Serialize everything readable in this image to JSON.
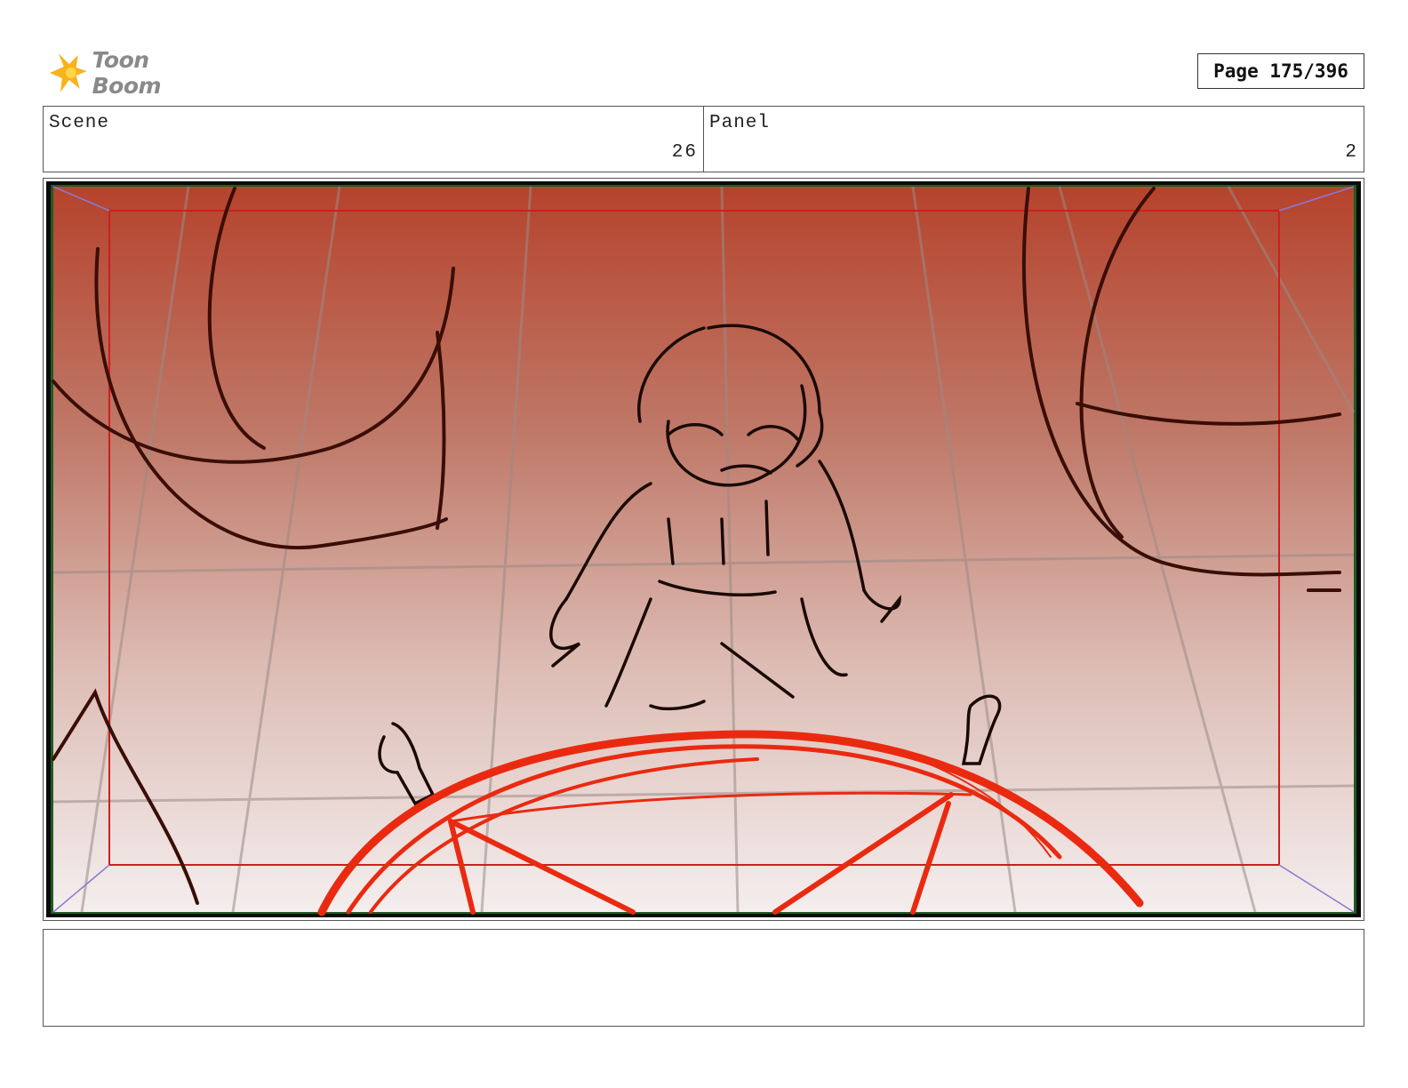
{
  "header": {
    "logo_text": "Toon Boom",
    "page_label": "Page 175/396"
  },
  "fields": {
    "scene_label": "Scene",
    "scene_value": "26",
    "panel_label": "Panel",
    "panel_value": "2"
  },
  "colors": {
    "sky_top": "#b5432c",
    "sky_bottom": "#f4eeee",
    "safe_frame": "#cc1f1f",
    "magic_circle": "#ea2a10",
    "ink": "#2a0e08",
    "logo_spark": "#f7b21c"
  },
  "notes": {
    "text": ""
  }
}
